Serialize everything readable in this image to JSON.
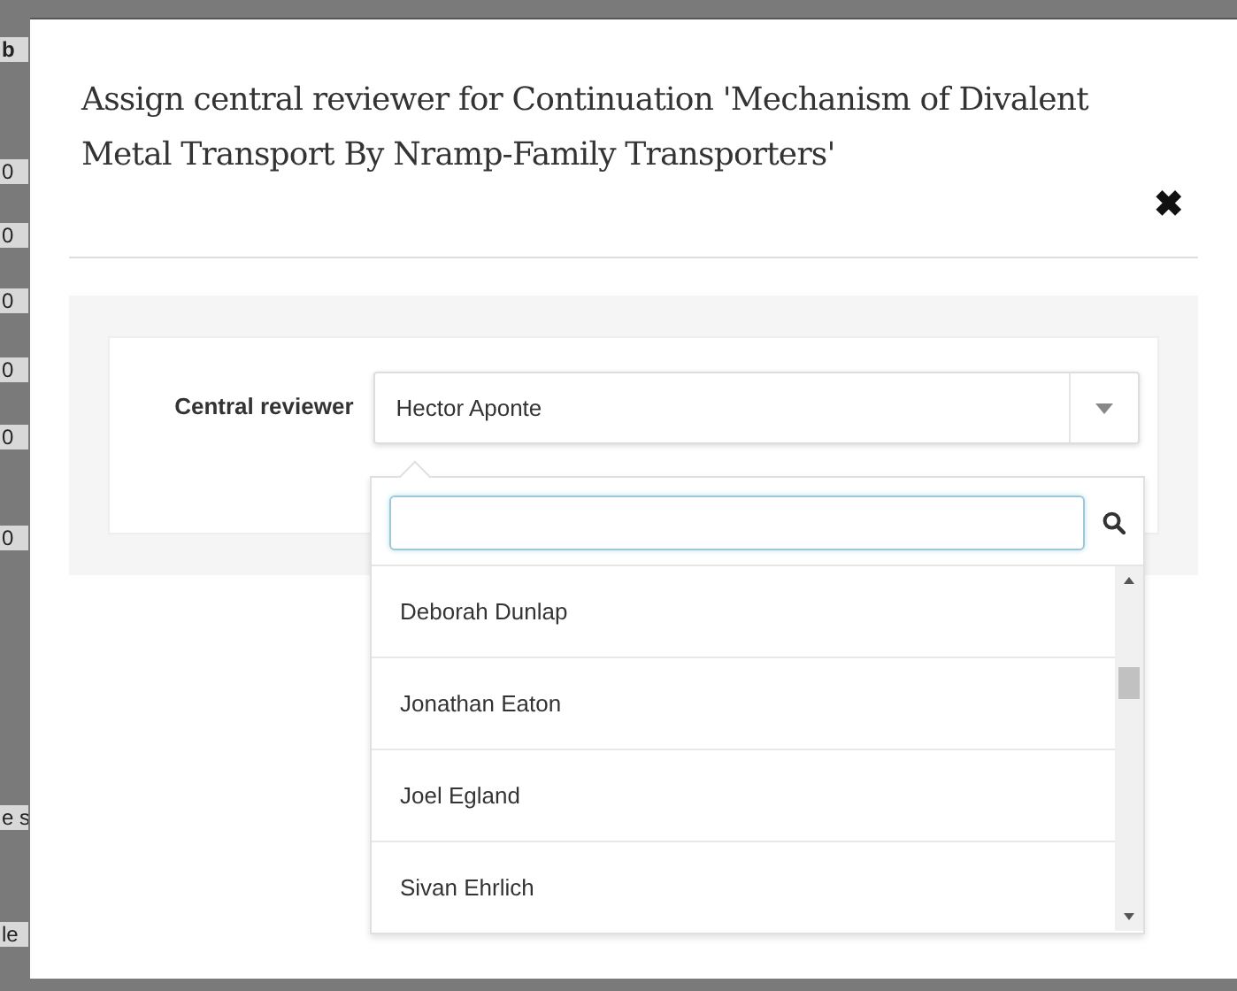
{
  "background_fragments": [
    "b",
    "0",
    "0",
    "0",
    "0",
    "0",
    "0",
    "e s",
    "le"
  ],
  "dialog": {
    "title": "Assign central reviewer for Continuation 'Mechanism of Divalent Metal Transport By Nramp-Family Transporters'",
    "close": "✖"
  },
  "form": {
    "label": "Central reviewer",
    "value": "Hector Aponte"
  },
  "dropdown": {
    "options": [
      {
        "label": "Deborah Dunlap",
        "selected": false
      },
      {
        "label": "Jonathan Eaton",
        "selected": false
      },
      {
        "label": "Joel Egland",
        "selected": false
      },
      {
        "label": "Sivan Ehrlich",
        "selected": false
      }
    ]
  }
}
